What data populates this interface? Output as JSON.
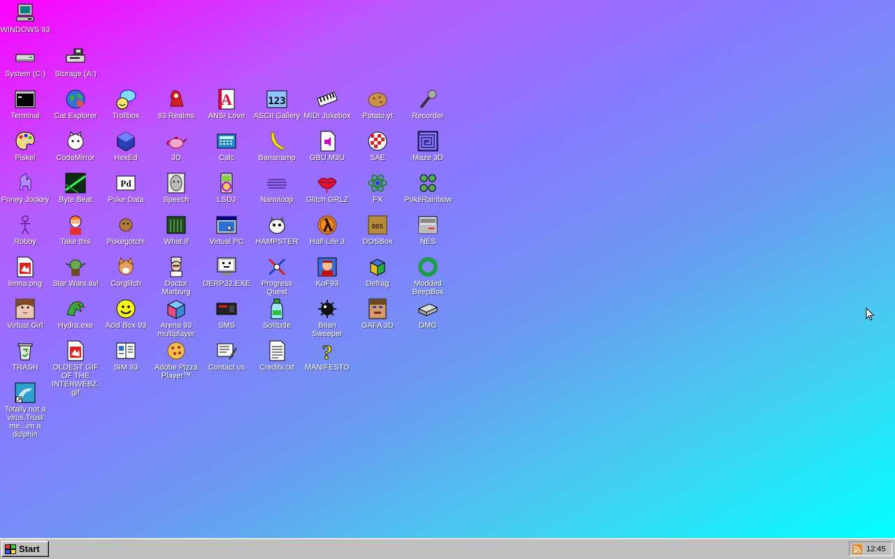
{
  "desktop": {
    "icons": [
      {
        "id": "windows93",
        "label": "WINDOWS 93",
        "icon": "computer-icon"
      },
      {
        "id": "system-c",
        "label": "System (C:)",
        "icon": "hard-drive-icon"
      },
      {
        "id": "storage-a",
        "label": "Storage (A:)",
        "icon": "floppy-drive-icon"
      },
      {
        "id": "terminal",
        "label": "Terminal",
        "icon": "terminal-icon"
      },
      {
        "id": "cat-explorer",
        "label": "Cat Explorer",
        "icon": "globe-icon"
      },
      {
        "id": "trollbox",
        "label": "Trollbox",
        "icon": "chat-icon"
      },
      {
        "id": "93-realms",
        "label": "93 Realms",
        "icon": "knight-icon"
      },
      {
        "id": "ansi-love",
        "label": "ANSI Love",
        "icon": "letter-a-icon"
      },
      {
        "id": "ascii-gallery",
        "label": "ASCII Gallery",
        "icon": "numbers-icon"
      },
      {
        "id": "midi-jukebox",
        "label": "MIDI Jukebox",
        "icon": "piano-icon"
      },
      {
        "id": "potato-yt",
        "label": "Potato.yt",
        "icon": "potato-icon"
      },
      {
        "id": "recorder",
        "label": "Recorder",
        "icon": "microphone-icon"
      },
      {
        "id": "piskel",
        "label": "Piskel",
        "icon": "palette-icon"
      },
      {
        "id": "codemirror",
        "label": "CodeMirror",
        "icon": "cat-icon"
      },
      {
        "id": "hexed",
        "label": "HexEd",
        "icon": "hexagon-icon"
      },
      {
        "id": "3d",
        "label": "3D",
        "icon": "teapot-icon"
      },
      {
        "id": "calc",
        "label": "Calc",
        "icon": "calculator-icon"
      },
      {
        "id": "bananamp",
        "label": "Bananamp",
        "icon": "banana-icon"
      },
      {
        "id": "gbu-m3u",
        "label": "GBU.M3U",
        "icon": "audio-file-icon"
      },
      {
        "id": "sae",
        "label": "SAE",
        "icon": "checkered-ball-icon"
      },
      {
        "id": "maze-3d",
        "label": "Maze 3D",
        "icon": "maze-icon"
      },
      {
        "id": "poney-jockey",
        "label": "Poney Jockey",
        "icon": "pony-icon"
      },
      {
        "id": "byte-beat",
        "label": "Byte Beat",
        "icon": "waveform-icon"
      },
      {
        "id": "puke-data",
        "label": "Puke Data",
        "icon": "pd-icon"
      },
      {
        "id": "speech",
        "label": "Speech",
        "icon": "face-icon"
      },
      {
        "id": "lsdj",
        "label": "LSDJ",
        "icon": "gameboy-icon"
      },
      {
        "id": "nanoloop",
        "label": "Nanoloop",
        "icon": "lines-icon"
      },
      {
        "id": "glitch-grlz",
        "label": "Glitch GRLZ",
        "icon": "lips-icon"
      },
      {
        "id": "fx",
        "label": "FX",
        "icon": "atom-icon"
      },
      {
        "id": "pokerainbow",
        "label": "PokéRainbow",
        "icon": "characters-icon"
      },
      {
        "id": "robby",
        "label": "Robby",
        "icon": "stick-figure-icon"
      },
      {
        "id": "take-this",
        "label": "Take this",
        "icon": "old-man-icon"
      },
      {
        "id": "pokegotchi",
        "label": "Pokegotchi",
        "icon": "pet-icon"
      },
      {
        "id": "what-if",
        "label": "What If",
        "icon": "chart-window-icon"
      },
      {
        "id": "virtual-pc",
        "label": "Virtual PC",
        "icon": "window-icon"
      },
      {
        "id": "hampster",
        "label": "HAMPSTER",
        "icon": "hamster-icon"
      },
      {
        "id": "half-life-3",
        "label": "Half-Life 3",
        "icon": "lambda-icon"
      },
      {
        "id": "dosbox",
        "label": "DOSBox",
        "icon": "box-icon"
      },
      {
        "id": "nes",
        "label": "NES",
        "icon": "console-icon"
      },
      {
        "id": "lenna",
        "label": "lenna.png",
        "icon": "image-file-icon"
      },
      {
        "id": "star-wars",
        "label": "Star Wars.avi",
        "icon": "yoda-icon"
      },
      {
        "id": "corglitch",
        "label": "Corglitch",
        "icon": "dog-icon"
      },
      {
        "id": "doctor-marburg",
        "label": "Doctor Marburg",
        "icon": "doctor-icon"
      },
      {
        "id": "derp32",
        "label": "DERP32.EXE",
        "icon": "monitor-face-icon"
      },
      {
        "id": "progress-quest",
        "label": "Progress Quest",
        "icon": "swords-icon"
      },
      {
        "id": "kof93",
        "label": "KoF93",
        "icon": "fighter-icon"
      },
      {
        "id": "defrag",
        "label": "Defrag",
        "icon": "cube-stack-icon"
      },
      {
        "id": "modded-beepbox",
        "label": "Modded BeepBox",
        "icon": "ring-icon"
      },
      {
        "id": "virtual-girl",
        "label": "Virtual Girl",
        "icon": "woman-icon"
      },
      {
        "id": "hydra",
        "label": "Hydra.exe",
        "icon": "dragon-icon"
      },
      {
        "id": "acid-box",
        "label": "Acid Box 93",
        "icon": "smiley-icon"
      },
      {
        "id": "arena-93",
        "label": "Arena 93 multiplayer",
        "icon": "colored-cube-icon"
      },
      {
        "id": "sms",
        "label": "SMS",
        "icon": "master-system-icon"
      },
      {
        "id": "solitude",
        "label": "Solitude",
        "icon": "bottle-icon"
      },
      {
        "id": "brian-sweeper",
        "label": "Brian Sweeper",
        "icon": "mine-icon"
      },
      {
        "id": "gafa-3d",
        "label": "GAFA 3D",
        "icon": "soldier-icon"
      },
      {
        "id": "dmg",
        "label": "DMG",
        "icon": "disk-drive-icon"
      },
      {
        "id": "trash",
        "label": "TRASH",
        "icon": "recycle-bin-icon"
      },
      {
        "id": "oldest-gif",
        "label": "OLDEST GIF OF THE INTERWEBZ.gif",
        "icon": "image-file-icon"
      },
      {
        "id": "sim93",
        "label": "SIM 93",
        "icon": "book-icon"
      },
      {
        "id": "adobe-pizza",
        "label": "Adobe Pizza Player™",
        "icon": "pizza-icon"
      },
      {
        "id": "contact-us",
        "label": "Contact us",
        "icon": "letter-icon"
      },
      {
        "id": "credits",
        "label": "Credits.txt",
        "icon": "text-file-icon"
      },
      {
        "id": "manifesto",
        "label": "MANIFESTO",
        "icon": "question-icon"
      },
      {
        "id": "dolphin",
        "label": "Totally not a virus.Trust me...im a dolphin",
        "icon": "dolphin-icon"
      }
    ]
  },
  "taskbar": {
    "start_label": "Start",
    "start_icon": "windows93-logo-icon",
    "tray_icon": "rss-icon",
    "clock": "12:45"
  },
  "colors": {
    "gradient_start": "#ff00ff",
    "gradient_end": "#00ffff",
    "taskbar": "#c0c0c0"
  }
}
